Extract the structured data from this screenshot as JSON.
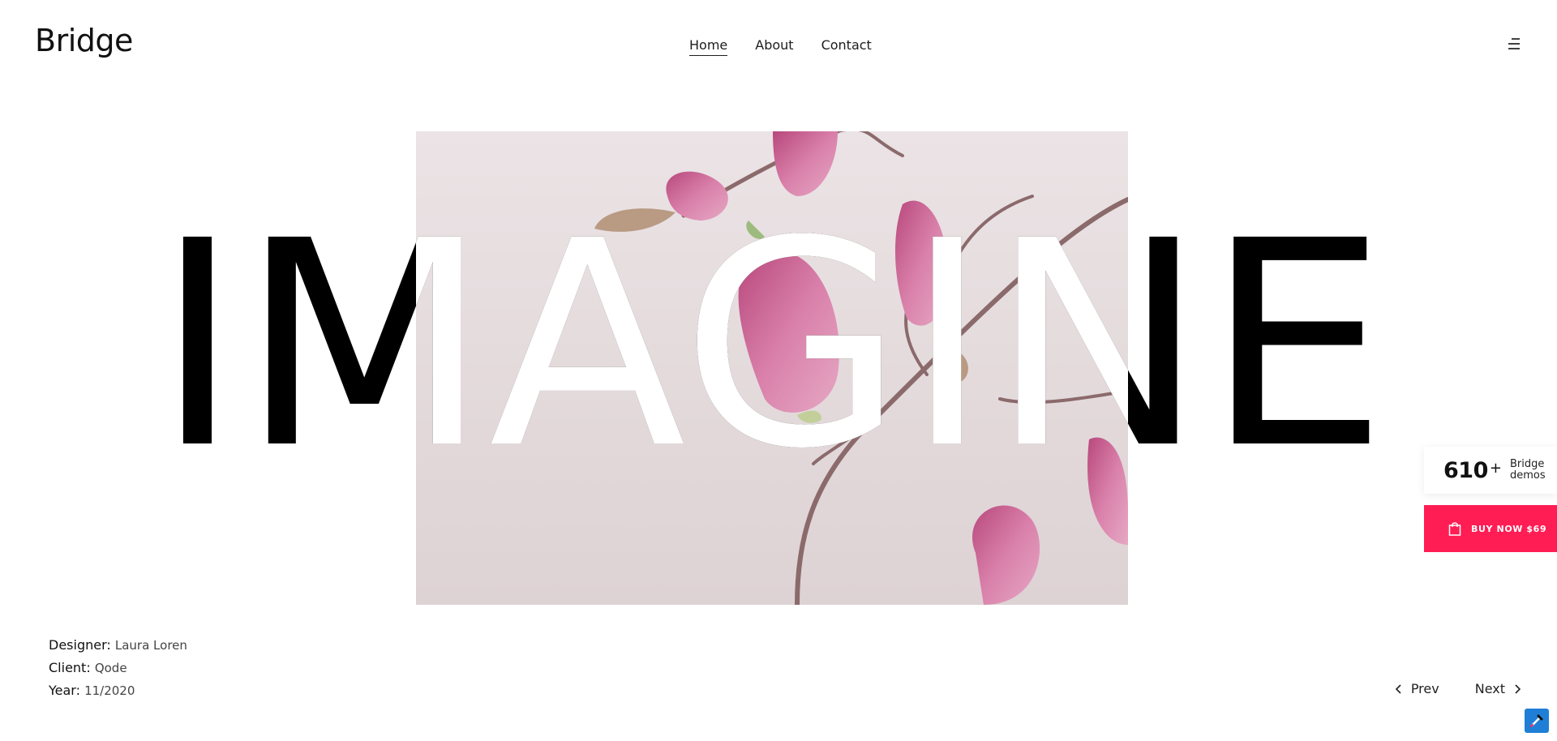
{
  "header": {
    "logo": "Bridge",
    "nav": [
      {
        "label": "Home",
        "active": true
      },
      {
        "label": "About",
        "active": false
      },
      {
        "label": "Contact",
        "active": false
      }
    ]
  },
  "hero": {
    "title": "IMAGINE"
  },
  "meta": {
    "designer_label": "Designer:",
    "designer_value": "Laura Loren",
    "client_label": "Client:",
    "client_value": "Qode",
    "year_label": "Year:",
    "year_value": "11/2020"
  },
  "pager": {
    "prev": "Prev",
    "next": "Next"
  },
  "side": {
    "demos_count": "610",
    "demos_plus": "+",
    "demos_line1": "Bridge",
    "demos_line2": "demos",
    "buy_label": "BUY NOW $69"
  },
  "colors": {
    "accent": "#ff1d54",
    "picker": "#1f7fd6",
    "image_bg": "#e8dfe1",
    "petal": "#c75d8f"
  },
  "icons": {
    "menu": "menu-icon",
    "prev": "chevron-left-icon",
    "next": "chevron-right-icon",
    "bag": "shopping-bag-icon",
    "picker": "eyedropper-icon"
  }
}
